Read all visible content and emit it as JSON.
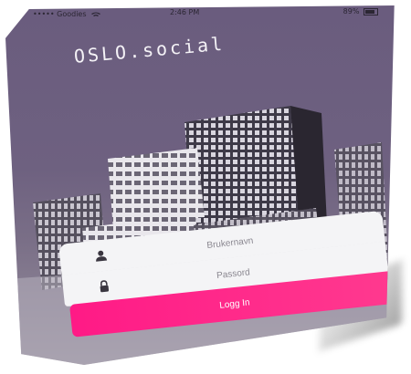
{
  "status_bar": {
    "carrier": "••••• Goodies",
    "time": "2:46 PM",
    "battery": "89%"
  },
  "app": {
    "logo": "OSLO.social"
  },
  "login": {
    "username_placeholder": "Brukernavn",
    "password_placeholder": "Passord",
    "button_label": "Logg In"
  },
  "icons": {
    "user": "user-icon",
    "lock": "lock-icon",
    "wifi": "wifi-icon",
    "battery": "battery-icon"
  },
  "colors": {
    "sky": "#6e6180",
    "accent": "#ff2a8a",
    "field": "#f4f4f6",
    "logo_text": "#f4f2f6"
  }
}
